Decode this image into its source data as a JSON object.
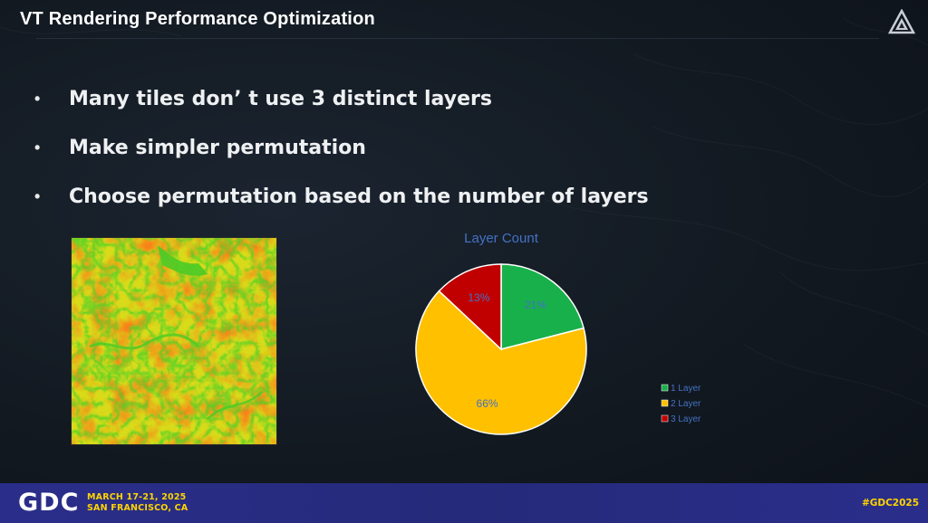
{
  "slide": {
    "title": "VT Rendering Performance Optimization",
    "bullets": [
      {
        "marker": "•",
        "text": "Many tiles don’ t use 3 distinct layers"
      },
      {
        "marker": "•",
        "text": "Make simpler permutation"
      },
      {
        "marker": "•",
        "text": "Choose permutation based on the number of layers"
      }
    ]
  },
  "icons": {
    "corner_logo": "triangle-logo-icon",
    "heatmap": "layer-heatmap-image"
  },
  "chart_data": {
    "type": "pie",
    "title": "Layer Count",
    "categories": [
      "1 Layer",
      "2 Layer",
      "3 Layer"
    ],
    "values": [
      21,
      66,
      13
    ],
    "labels": [
      "21%",
      "66%",
      "13%"
    ],
    "colors": [
      "#18b04a",
      "#ffc000",
      "#c00000"
    ],
    "legend_position": "right-bottom",
    "label_color": "#4472c4"
  },
  "footer": {
    "logo": "GDC",
    "dates_line1": "MARCH 17-21, 2025",
    "dates_line2": "SAN FRANCISCO, CA",
    "hashtag": "#GDC2025"
  },
  "colors": {
    "background": "#121921",
    "footer": "#2a2e8a",
    "accent_yellow": "#ffd400",
    "chart_title": "#4472c4"
  }
}
